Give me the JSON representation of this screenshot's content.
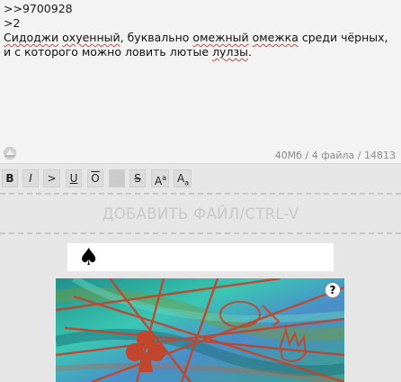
{
  "post": {
    "line1": ">>9700928",
    "line2": ">2",
    "w1": "Сидоджи",
    "w2": " ",
    "w3": "охуенный",
    "w4": ", буквально ",
    "w5": "омежный",
    "w6": " ",
    "w7": "омежка",
    "w8": " среди чёрных, и с которого можно ловить лютые ",
    "w9": "лулзы",
    "w10": "."
  },
  "stats": {
    "text": "40Мб / 4 файла / 14813"
  },
  "toolbar": {
    "bold": "B",
    "italic": "I",
    "quote": ">",
    "underline": "U",
    "overline": "O",
    "strike": "S",
    "sup_a": "A",
    "sup_b": "a",
    "sub_a": "A",
    "sub_b": "a"
  },
  "dropzone": {
    "label": "ДОБАВИТЬ ФАЙЛ/CTRL-V"
  },
  "captcha": {
    "prompt_symbol": "♠",
    "help": "?"
  },
  "icons": [
    "resize-icon",
    "spade-icon",
    "help-icon"
  ],
  "colors": {
    "spellcheck": "#e0403a",
    "captcha_red": "#c2452d",
    "captcha_teal": "#2fb7a8"
  }
}
